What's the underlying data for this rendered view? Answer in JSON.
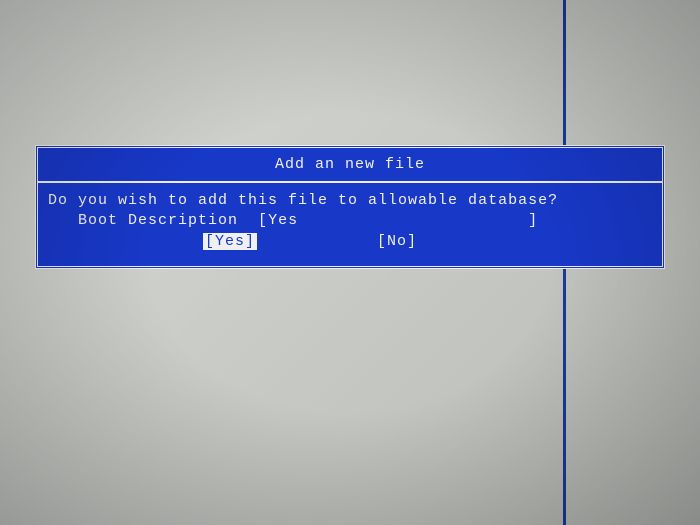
{
  "dialog": {
    "title": "Add an new file",
    "message": "Do you wish to add this file to allowable database?",
    "input_label": "Boot Description",
    "input_open": "[",
    "input_value": "Yes",
    "input_close": "]",
    "yes_label": "[Yes]",
    "no_label": "[No]"
  }
}
